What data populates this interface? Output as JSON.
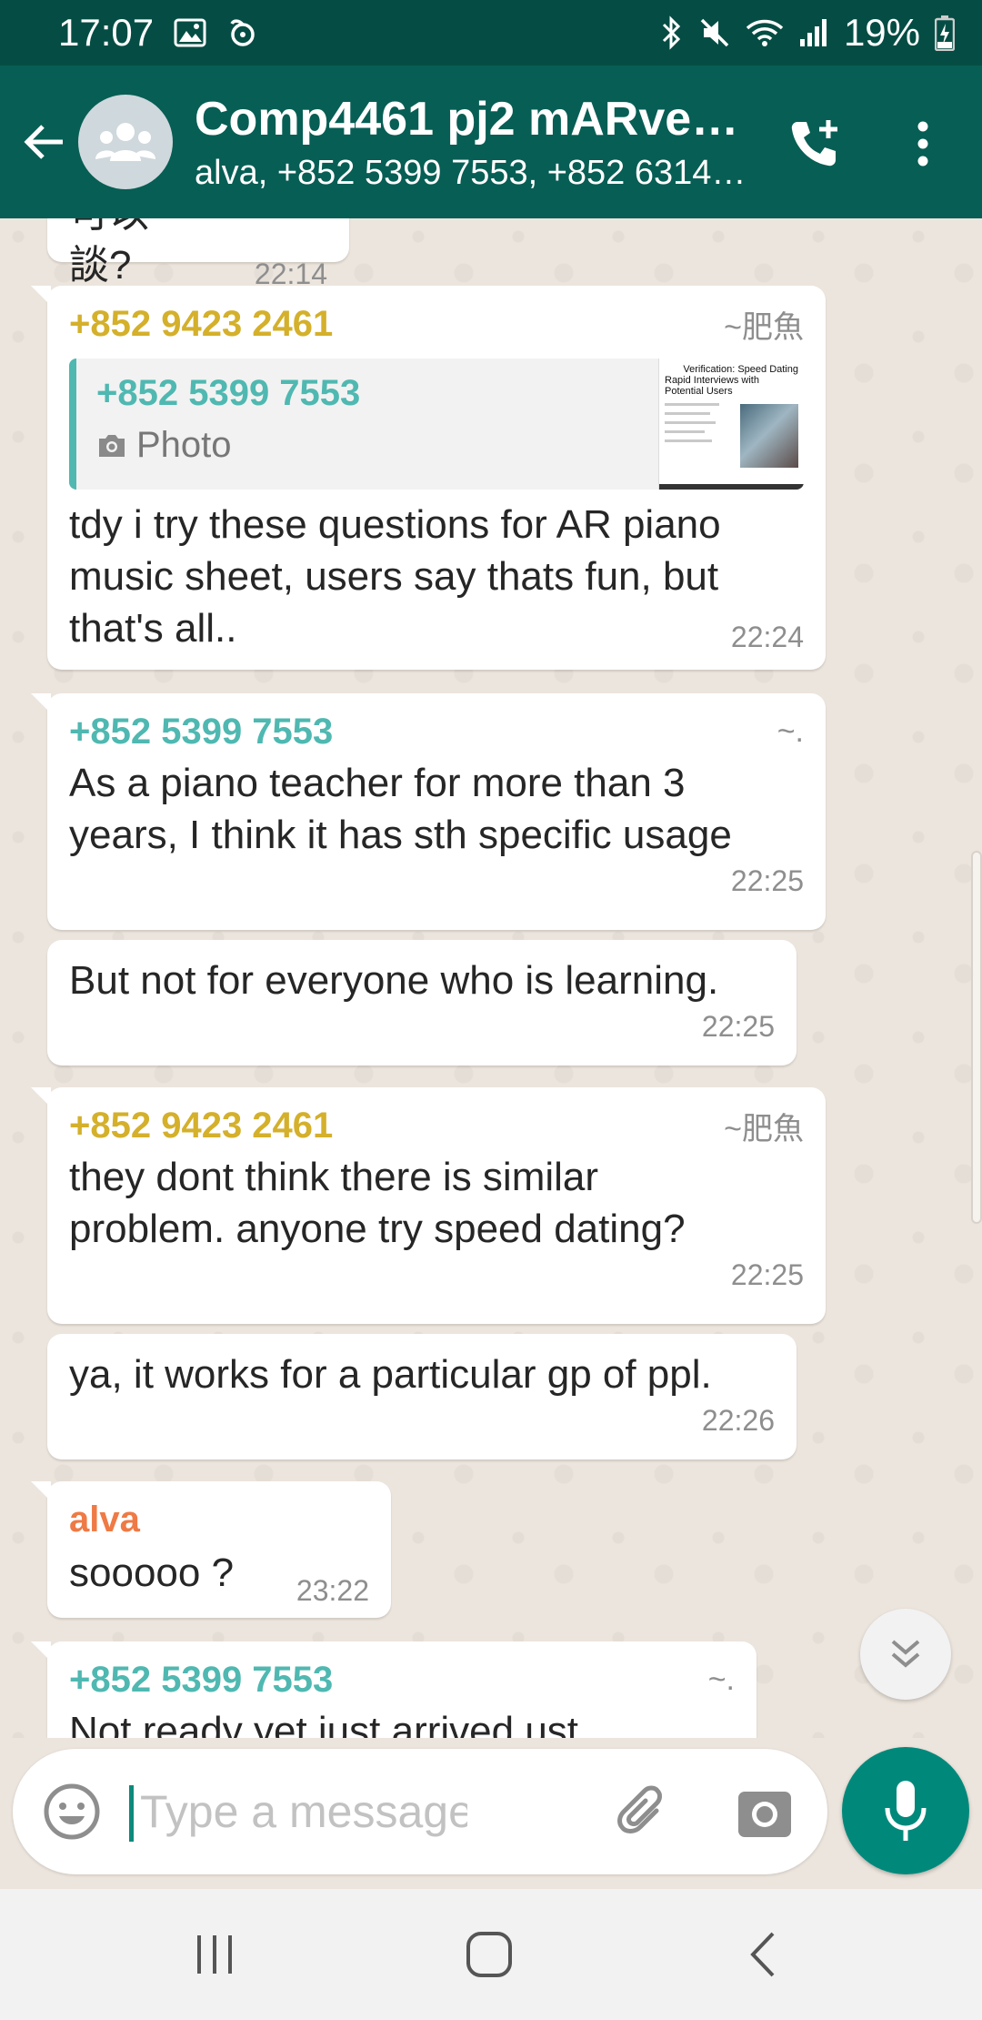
{
  "status_bar": {
    "time": "17:07",
    "battery": "19%",
    "icons": [
      "gallery-icon",
      "sync-icon",
      "bluetooth-icon",
      "mute-icon",
      "wifi-icon",
      "signal-icon",
      "battery-charging-icon"
    ]
  },
  "header": {
    "title": "Comp4461 pj2 mARvel…",
    "subtitle": "alva, +852 5399 7553, +852 6314…",
    "icons": [
      "back-arrow-icon",
      "group-avatar-icon",
      "add-call-icon",
      "more-vert-icon"
    ]
  },
  "messages": [
    {
      "text": "可以談?",
      "time": "22:14"
    },
    {
      "sender": "+852 9423 2461",
      "sender_color": "#d4b02b",
      "nickname": "~肥魚",
      "quote": {
        "sender": "+852 5399 7553",
        "text": "Photo",
        "thumbnail_title": "Verification: Speed Dating",
        "thumbnail_subtitle": "Rapid Interviews with Potential Users"
      },
      "text_lines": [
        "tdy i try these questions for AR piano",
        "music sheet, users say thats fun, but",
        "that's all.."
      ],
      "time": "22:24"
    },
    {
      "sender": "+852 5399 7553",
      "sender_color": "#4fb8b1",
      "nickname": "~.",
      "text_lines": [
        "As a piano teacher for more than 3",
        "years, I think it has sth specific usage"
      ],
      "time": "22:25"
    },
    {
      "text": "But not for everyone who is learning.",
      "time": "22:25"
    },
    {
      "sender": "+852 9423 2461",
      "sender_color": "#d4b02b",
      "nickname": "~肥魚",
      "text_lines": [
        "they dont think there is similar",
        "problem. anyone try speed dating?"
      ],
      "time": "22:25"
    },
    {
      "text": "ya, it works for a particular gp of ppl.",
      "time": "22:26"
    },
    {
      "sender": "alva",
      "sender_color": "#ef7a45",
      "text": "sooooo ?",
      "time": "23:22"
    },
    {
      "sender": "+852 5399 7553",
      "sender_color": "#4fb8b1",
      "nickname": "~.",
      "text": "Not ready yet just arrived ust"
    }
  ],
  "input": {
    "placeholder": "Type a message",
    "icons": [
      "emoji-icon",
      "attach-icon",
      "camera-icon",
      "mic-icon"
    ]
  },
  "nav": {
    "icons": [
      "recent-apps-icon",
      "home-icon",
      "back-icon"
    ]
  }
}
